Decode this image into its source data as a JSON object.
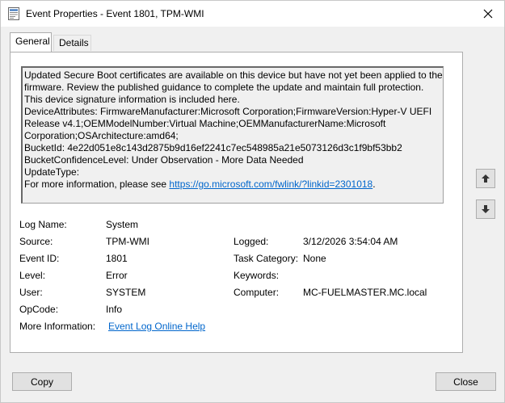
{
  "window": {
    "title": "Event Properties - Event 1801, TPM-WMI",
    "icons": {
      "app": "event-viewer-icon",
      "close": "close-icon"
    }
  },
  "tabs": [
    {
      "label": "General",
      "selected": true
    },
    {
      "label": "Details",
      "selected": false
    }
  ],
  "description": {
    "lines": [
      "Updated Secure Boot certificates are available on this device but have not yet been applied to the",
      "firmware. Review the published guidance to complete the update and maintain full protection.",
      "This device signature information is included here.",
      "DeviceAttributes: FirmwareManufacturer:Microsoft Corporation;FirmwareVersion:Hyper-V UEFI",
      "Release v4.1;OEMModelNumber:Virtual Machine;OEMManufacturerName:Microsoft",
      "Corporation;OSArchitecture:amd64;",
      "BucketId: 4e22d051e8c143d2875b9d16ef2241c7ec548985a21e5073126d3c1f9bf53bb2",
      "BucketConfidenceLevel: Under Observation - More Data Needed",
      "UpdateType:"
    ],
    "info_prefix": "For more information, please see ",
    "info_link": "https://go.microsoft.com/fwlink/?linkid=2301018",
    "info_suffix": "."
  },
  "fields": {
    "log_name": {
      "label": "Log Name:",
      "value": "System"
    },
    "source": {
      "label": "Source:",
      "value": "TPM-WMI"
    },
    "event_id": {
      "label": "Event ID:",
      "value": "1801"
    },
    "level": {
      "label": "Level:",
      "value": "Error"
    },
    "user": {
      "label": "User:",
      "value": "SYSTEM"
    },
    "opcode": {
      "label": "OpCode:",
      "value": "Info"
    },
    "more_info": {
      "label": "More Information:",
      "value": "Event Log Online Help"
    },
    "logged": {
      "label": "Logged:",
      "value": "3/12/2026 3:54:04 AM"
    },
    "task_category": {
      "label": "Task Category:",
      "value": "None"
    },
    "keywords": {
      "label": "Keywords:",
      "value": ""
    },
    "computer": {
      "label": "Computer:",
      "value": "MC-FUELMASTER.MC.local"
    }
  },
  "nav": {
    "up_icon": "arrow-up-icon",
    "down_icon": "arrow-down-icon"
  },
  "buttons": {
    "copy": "Copy",
    "close": "Close"
  }
}
